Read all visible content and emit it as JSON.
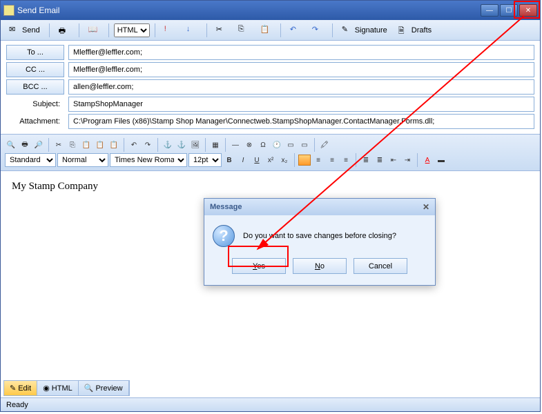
{
  "window": {
    "title": "Send Email"
  },
  "toolbar": {
    "send": "Send",
    "format_select": "HTML",
    "signature": "Signature",
    "drafts": "Drafts"
  },
  "fields": {
    "to_label": "To ...",
    "to_value": "Mleffler@leffler.com;",
    "cc_label": "CC ...",
    "cc_value": "Mleffler@leffler.com;",
    "bcc_label": "BCC ...",
    "bcc_value": "allen@leffler.com;",
    "subject_label": "Subject:",
    "subject_value": "StampShopManager",
    "attachment_label": "Attachment:",
    "attachment_value": "C:\\Program Files (x86)\\Stamp Shop Manager\\Connectweb.StampShopManager.ContactManager.Forms.dll;"
  },
  "editor": {
    "style": "Standard",
    "para": "Normal",
    "font": "Times New Roman",
    "size": "12pt",
    "body": "My Stamp Company"
  },
  "tabs": {
    "edit": "Edit",
    "html": "HTML",
    "preview": "Preview"
  },
  "status": "Ready",
  "dialog": {
    "title": "Message",
    "text": "Do you want to save changes before closing?",
    "yes": "Yes",
    "no": "No",
    "cancel": "Cancel"
  }
}
